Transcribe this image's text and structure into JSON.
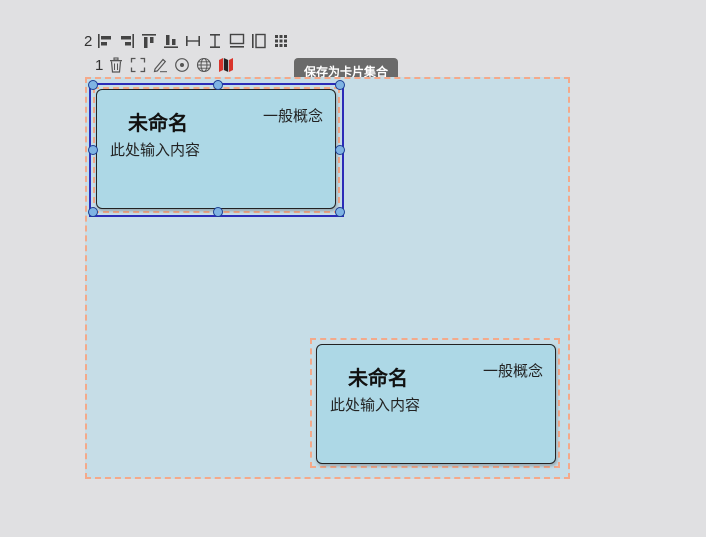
{
  "toolbar_multi": {
    "selected_count": "2",
    "tools": [
      "align-left-icon",
      "align-right-icon",
      "align-top-icon",
      "align-bottom-icon",
      "distribute-horizontal-icon",
      "distribute-vertical-icon",
      "same-width-icon",
      "same-height-icon",
      "grid-arrange-icon"
    ]
  },
  "toolbar_single": {
    "selected_count": "1",
    "tools": [
      "delete-icon",
      "fullscreen-icon",
      "edit-icon",
      "target-icon",
      "globe-icon",
      "map-icon"
    ]
  },
  "tooltip": {
    "text": "保存为卡片集合"
  },
  "cards": [
    {
      "title": "未命名",
      "type": "一般概念",
      "body": "此处输入内容"
    },
    {
      "title": "未命名",
      "type": "一般概念",
      "body": "此处输入内容"
    }
  ],
  "colors": {
    "canvas_bg": "#e0e0e2",
    "collection_bg": "#c6dde7",
    "dashed_border": "#f4a98a",
    "card_bg": "#add8e6",
    "selection_border": "#2b2bb8",
    "handle_fill": "#7fb3e3",
    "tooltip_bg": "#6a6a6a",
    "map_icon_color": "#d9342b"
  }
}
